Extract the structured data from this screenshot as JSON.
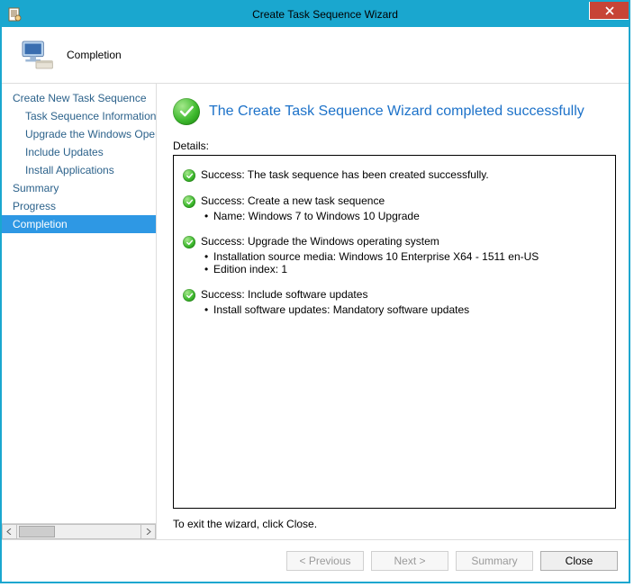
{
  "window": {
    "title": "Create Task Sequence Wizard"
  },
  "header": {
    "page_title": "Completion"
  },
  "sidebar": {
    "items": [
      {
        "label": "Create New Task Sequence",
        "indent": 0
      },
      {
        "label": "Task Sequence Information",
        "indent": 1
      },
      {
        "label": "Upgrade the Windows Operating System",
        "indent": 1
      },
      {
        "label": "Include Updates",
        "indent": 1
      },
      {
        "label": "Install Applications",
        "indent": 1
      },
      {
        "label": "Summary",
        "indent": 0
      },
      {
        "label": "Progress",
        "indent": 0
      },
      {
        "label": "Completion",
        "indent": 0,
        "selected": true
      }
    ]
  },
  "main": {
    "heading": "The Create Task Sequence Wizard completed successfully",
    "details_label": "Details:",
    "statuses": [
      {
        "text": "Success: The task sequence has been created successfully.",
        "sublines": []
      },
      {
        "text": "Success: Create a new task sequence",
        "sublines": [
          "Name: Windows 7 to Windows 10 Upgrade"
        ]
      },
      {
        "text": "Success: Upgrade the Windows operating system",
        "sublines": [
          "Installation source media:  Windows 10 Enterprise X64 - 1511 en-US",
          "Edition index: 1"
        ]
      },
      {
        "text": "Success: Include software updates",
        "sublines": [
          "Install software updates: Mandatory software updates"
        ]
      }
    ],
    "exit_hint": "To exit the wizard, click Close."
  },
  "footer": {
    "previous": "< Previous",
    "next": "Next >",
    "summary": "Summary",
    "close": "Close"
  }
}
